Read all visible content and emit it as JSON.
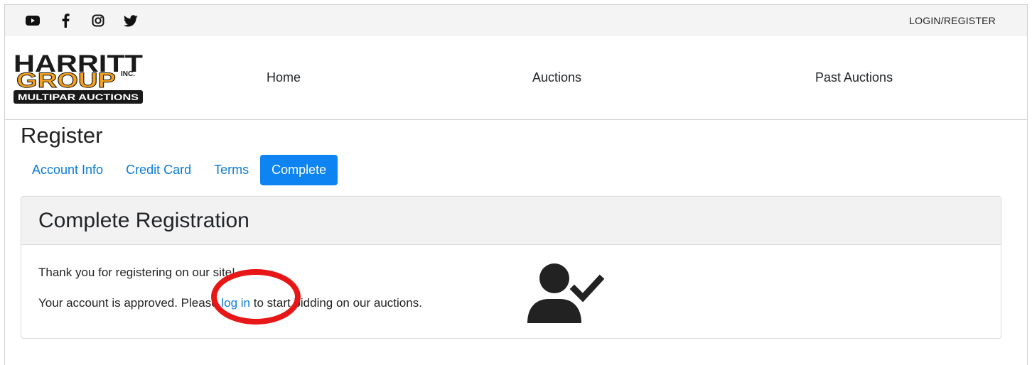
{
  "topbar": {
    "social_icons": [
      "youtube-icon",
      "facebook-icon",
      "instagram-icon",
      "twitter-icon"
    ],
    "login_label": "LOGIN/REGISTER"
  },
  "logo": {
    "line1": "HARRITT",
    "line2": "GROUP",
    "suffix": "INC.",
    "tagline": "MULTIPAR AUCTIONS",
    "colors": {
      "dark": "#1a1a1a",
      "accent": "#f6a21d"
    }
  },
  "nav": {
    "items": [
      {
        "label": "Home"
      },
      {
        "label": "Auctions"
      },
      {
        "label": "Past Auctions"
      }
    ]
  },
  "page": {
    "title": "Register"
  },
  "steps": {
    "items": [
      {
        "label": "Account Info",
        "active": false
      },
      {
        "label": "Credit Card",
        "active": false
      },
      {
        "label": "Terms",
        "active": false
      },
      {
        "label": "Complete",
        "active": true
      }
    ]
  },
  "card": {
    "title": "Complete Registration",
    "thanks": "Thank you for registering on our site!",
    "approved_prefix": "Your account is approved. Please ",
    "login_link": "log in",
    "approved_suffix": " to start bidding on our auctions.",
    "icon": "user-check-icon"
  },
  "colors": {
    "link": "#0a7bd8",
    "active_step": "#0d84f2",
    "annotation": "#e81717"
  }
}
